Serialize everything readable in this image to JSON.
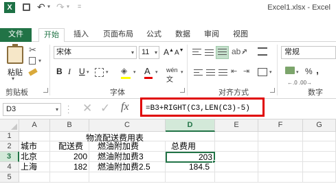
{
  "window": {
    "app_logo": "X",
    "title": "Excel1.xlsx - Excel"
  },
  "quick_access": {
    "icons": [
      "save-icon",
      "undo-icon",
      "redo-icon",
      "customize-icon"
    ],
    "undo_dd": "▾",
    "redo_dd": "▾",
    "customize": "="
  },
  "tabs": [
    {
      "label": "文件",
      "active": false
    },
    {
      "label": "开始",
      "active": true
    },
    {
      "label": "插入",
      "active": false
    },
    {
      "label": "页面布局",
      "active": false
    },
    {
      "label": "公式",
      "active": false
    },
    {
      "label": "数据",
      "active": false
    },
    {
      "label": "审阅",
      "active": false
    },
    {
      "label": "视图",
      "active": false
    }
  ],
  "ribbon": {
    "clipboard": {
      "paste_label": "粘贴",
      "group_label": "剪贴板"
    },
    "font": {
      "font_name": "宋体",
      "font_size": "11",
      "grow_label": "A",
      "shrink_label": "A",
      "bold": "B",
      "italic": "I",
      "underline": "U",
      "font_color_label": "A",
      "wen_label": "wén",
      "group_label": "字体"
    },
    "alignment": {
      "group_label": "对齐方式"
    },
    "number": {
      "format": "常规",
      "percent": "%",
      "comma": ",",
      "group_label": "数字"
    }
  },
  "colors": {
    "accent": "#217346",
    "highlight_box": "#e00000",
    "fill_color": "#ffff00",
    "font_color": "#e60000"
  },
  "formula_bar": {
    "name_box": "D3",
    "cancel": "✕",
    "enter": "✓",
    "fx": "fx",
    "formula": "=B3+RIGHT(C3,LEN(C3)-5)"
  },
  "sheet": {
    "columns": [
      "A",
      "B",
      "C",
      "D",
      "E",
      "F",
      "G"
    ],
    "active_column": "D",
    "rows": [
      "1",
      "2",
      "3",
      "4",
      "5"
    ],
    "active_row": "3",
    "title": "物流配送费用表",
    "cells": {
      "A2": "城市",
      "B2": "配送费",
      "C2": "燃油附加费",
      "D2": "总费用",
      "A3": "北京",
      "B3": "200",
      "C3": "燃油附加费3",
      "D3": "203",
      "A4": "上海",
      "B4": "182",
      "C4": "燃油附加费2.5",
      "D4": "184.5"
    }
  }
}
